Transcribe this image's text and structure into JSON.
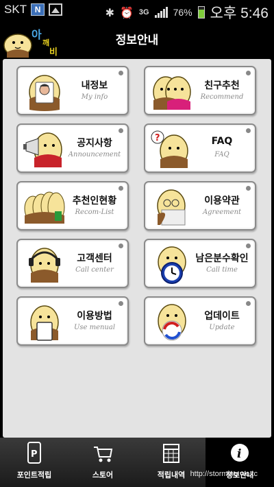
{
  "statusbar": {
    "carrier": "SKT",
    "notification_icon": "N",
    "network": "3G",
    "battery": "76%",
    "time": "오후 5:46"
  },
  "header": {
    "logo_text": "아깨비",
    "title": "정보안내"
  },
  "menu": [
    {
      "kr": "내정보",
      "en": "My info",
      "icon": "id-card-icon"
    },
    {
      "kr": "친구추천",
      "en": "Recommend",
      "icon": "friends-icon"
    },
    {
      "kr": "공지사항",
      "en": "Announcement",
      "icon": "megaphone-icon"
    },
    {
      "kr": "FAQ",
      "en": "FAQ",
      "icon": "question-icon"
    },
    {
      "kr": "추천인현황",
      "en": "Recom-List",
      "icon": "group-icon"
    },
    {
      "kr": "이용약관",
      "en": "Agreement",
      "icon": "scroll-icon"
    },
    {
      "kr": "고객센터",
      "en": "Call center",
      "icon": "headset-icon"
    },
    {
      "kr": "남은분수확인",
      "en": "Call time",
      "icon": "clock-icon"
    },
    {
      "kr": "이용방법",
      "en": "Use menual",
      "icon": "tablet-icon"
    },
    {
      "kr": "업데이트",
      "en": "Update",
      "icon": "refresh-icon"
    }
  ],
  "bottomnav": [
    {
      "label": "포인트적립",
      "icon": "phone-p-icon"
    },
    {
      "label": "스토어",
      "icon": "cart-icon"
    },
    {
      "label": "적립내역",
      "icon": "calendar-icon"
    },
    {
      "label": "정보안내",
      "icon": "info-icon",
      "active": true
    }
  ],
  "watermark": "http://storming.wo.tc",
  "colors": {
    "mascot": "#f6e39a",
    "mascot_outline": "#5a4a10",
    "cloth": "#8b5a2b",
    "active_tab": "#000000"
  }
}
